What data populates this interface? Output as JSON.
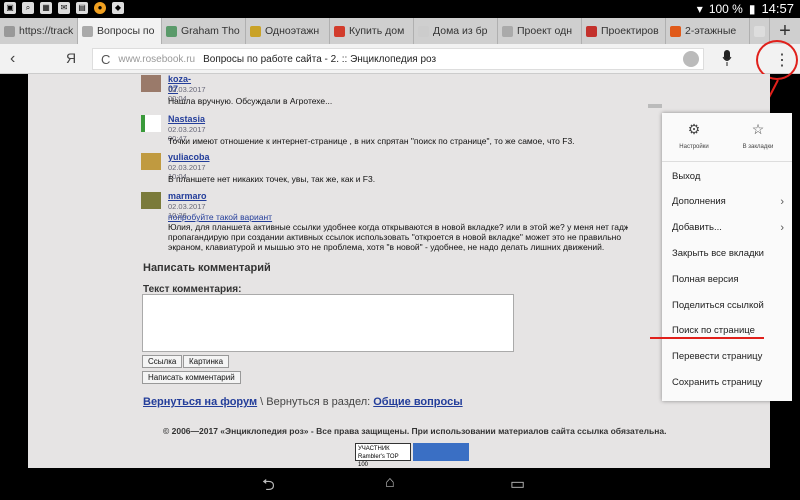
{
  "status": {
    "battery": "100 %",
    "time": "14:57"
  },
  "tabs": [
    {
      "label": "https://track",
      "color": "#999999"
    },
    {
      "label": "Вопросы по",
      "color": "#aaaaaa"
    },
    {
      "label": "Graham Tho",
      "color": "#5a9a6a"
    },
    {
      "label": "Одноэтажн",
      "color": "#c9a227"
    },
    {
      "label": "Купить дом",
      "color": "#d23c2c"
    },
    {
      "label": "Дома из бр",
      "color": "#cccccc"
    },
    {
      "label": "Проект одн",
      "color": "#aaaaaa"
    },
    {
      "label": "Проектиров",
      "color": "#c3312c"
    },
    {
      "label": "2-этажные",
      "color": "#e05a1a"
    },
    {
      "label": "",
      "color": "#dddddd"
    }
  ],
  "toolbar": {
    "back": "‹",
    "ya": "Я",
    "domain": "www.rosebook.ru",
    "title": "Вопросы по работе сайта - 2. :: Энциклопедия роз",
    "kebab": "⋮",
    "newtab": "+"
  },
  "comments": [
    {
      "author": "koza-07",
      "date": "02.03.2017 00:04",
      "text": "Нашла вручную. Обсуждали в Агротехе..."
    },
    {
      "author": "Nastasia",
      "date": "02.03.2017 00:47",
      "text": "Точки имеют отношение к интернет-странице , в них спрятан \"поиск по странице\", то же самое, что F3."
    },
    {
      "author": "yuliacoba",
      "date": "02.03.2017 10:04",
      "text": "В планшете нет никаких точек, увы, так же, как и F3."
    },
    {
      "author": "marmaro",
      "date": "02.03.2017 10:26",
      "link": "попробуйте такой вариант",
      "text1": "Юлия, для планшета активные ссылки удобнее когда открываются в новой вкладке? или в этой же? у меня нет гадж",
      "text2": "пропагандирую при создании активных ссылок использовать \"откроется в новой вкладке\" может это не правильно",
      "text3": "экраном, клавиатурой и мышью это не проблема, хотя \"в новой\" - удобнее, не надо делать лишних движений."
    }
  ],
  "form": {
    "heading": "Написать комментарий",
    "label": "Текст комментария:",
    "link_btn": "Ссылка",
    "image_btn": "Картинка",
    "submit_btn": "Написать комментарий"
  },
  "footer": {
    "back_forum": "Вернуться на форум",
    "sep": " \\ Вернуться в раздел: ",
    "section": "Общие вопросы",
    "copyright": "© 2006—2017 «Энциклопедия роз» - Все права защищены. При использовании материалов сайта ссылка обязательна.",
    "counter1": "УЧАСТНИК Rambler's TOP 100"
  },
  "menu": {
    "settings": "Настройки",
    "bookmarks": "В закладки",
    "items": [
      "Выход",
      "Дополнения",
      "Добавить...",
      "Закрыть все вкладки",
      "Полная версия",
      "Поделиться ссылкой",
      "Поиск по странице",
      "Перевести страницу",
      "Сохранить страницу"
    ]
  }
}
